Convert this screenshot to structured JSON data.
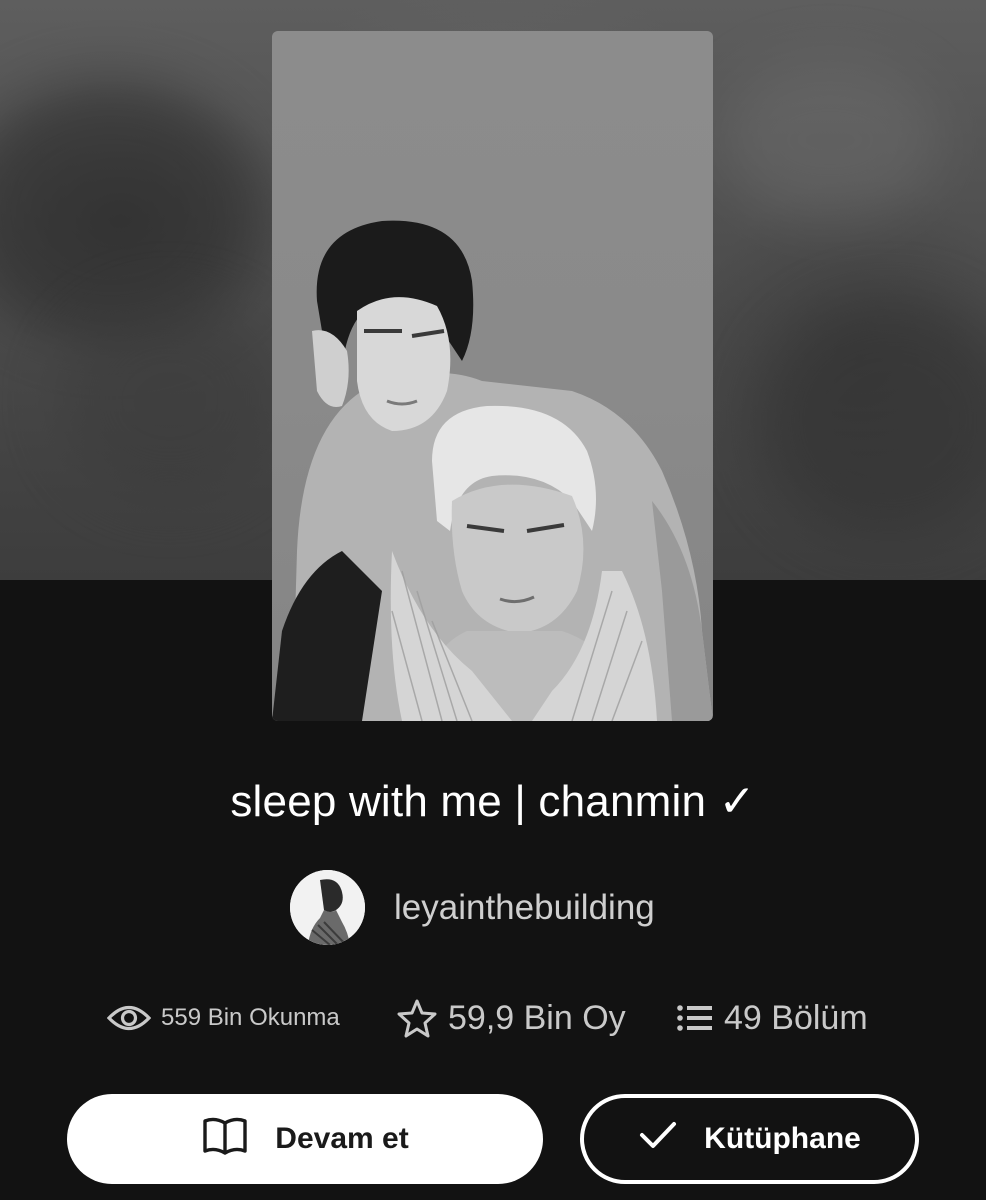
{
  "story": {
    "title": "sleep with me | chanmin ✓",
    "author": "leyainthebuilding"
  },
  "stats": {
    "reads": "559 Bin Okunma",
    "votes": "59,9 Bin Oy",
    "parts": "49 Bölüm"
  },
  "actions": {
    "continue_label": "Devam et",
    "library_label": "Kütüphane"
  },
  "icons": {
    "reads": "eye-icon",
    "votes": "star-icon",
    "parts": "list-icon",
    "continue": "book-icon",
    "library": "check-icon"
  },
  "colors": {
    "background": "#121212",
    "primary_button": "#ffffff",
    "muted_text": "#c9c9c9"
  }
}
